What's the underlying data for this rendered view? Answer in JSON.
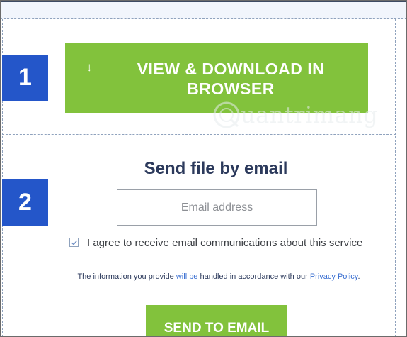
{
  "steps": {
    "one": "1",
    "two": "2"
  },
  "download": {
    "arrow": "↓",
    "label_line1": "VIEW & DOWNLOAD IN",
    "label_line2": "BROWSER"
  },
  "email_section": {
    "title": "Send file by email",
    "input_placeholder": "Email address",
    "input_value": "",
    "consent_label": "I agree to receive email communications about this service",
    "consent_checked": true,
    "privacy_part1": "The information you provide ",
    "privacy_highlight": "will be",
    "privacy_part2": " handled in accordance with our ",
    "privacy_link": "Privacy Policy",
    "privacy_end": ".",
    "send_label": "SEND TO EMAIL"
  },
  "watermark": {
    "text": "uantrimang"
  },
  "colors": {
    "accent_green": "#82c23c",
    "badge_blue": "#2456c9",
    "title_navy": "#2c3a5c",
    "link_blue": "#3a6fd1"
  }
}
